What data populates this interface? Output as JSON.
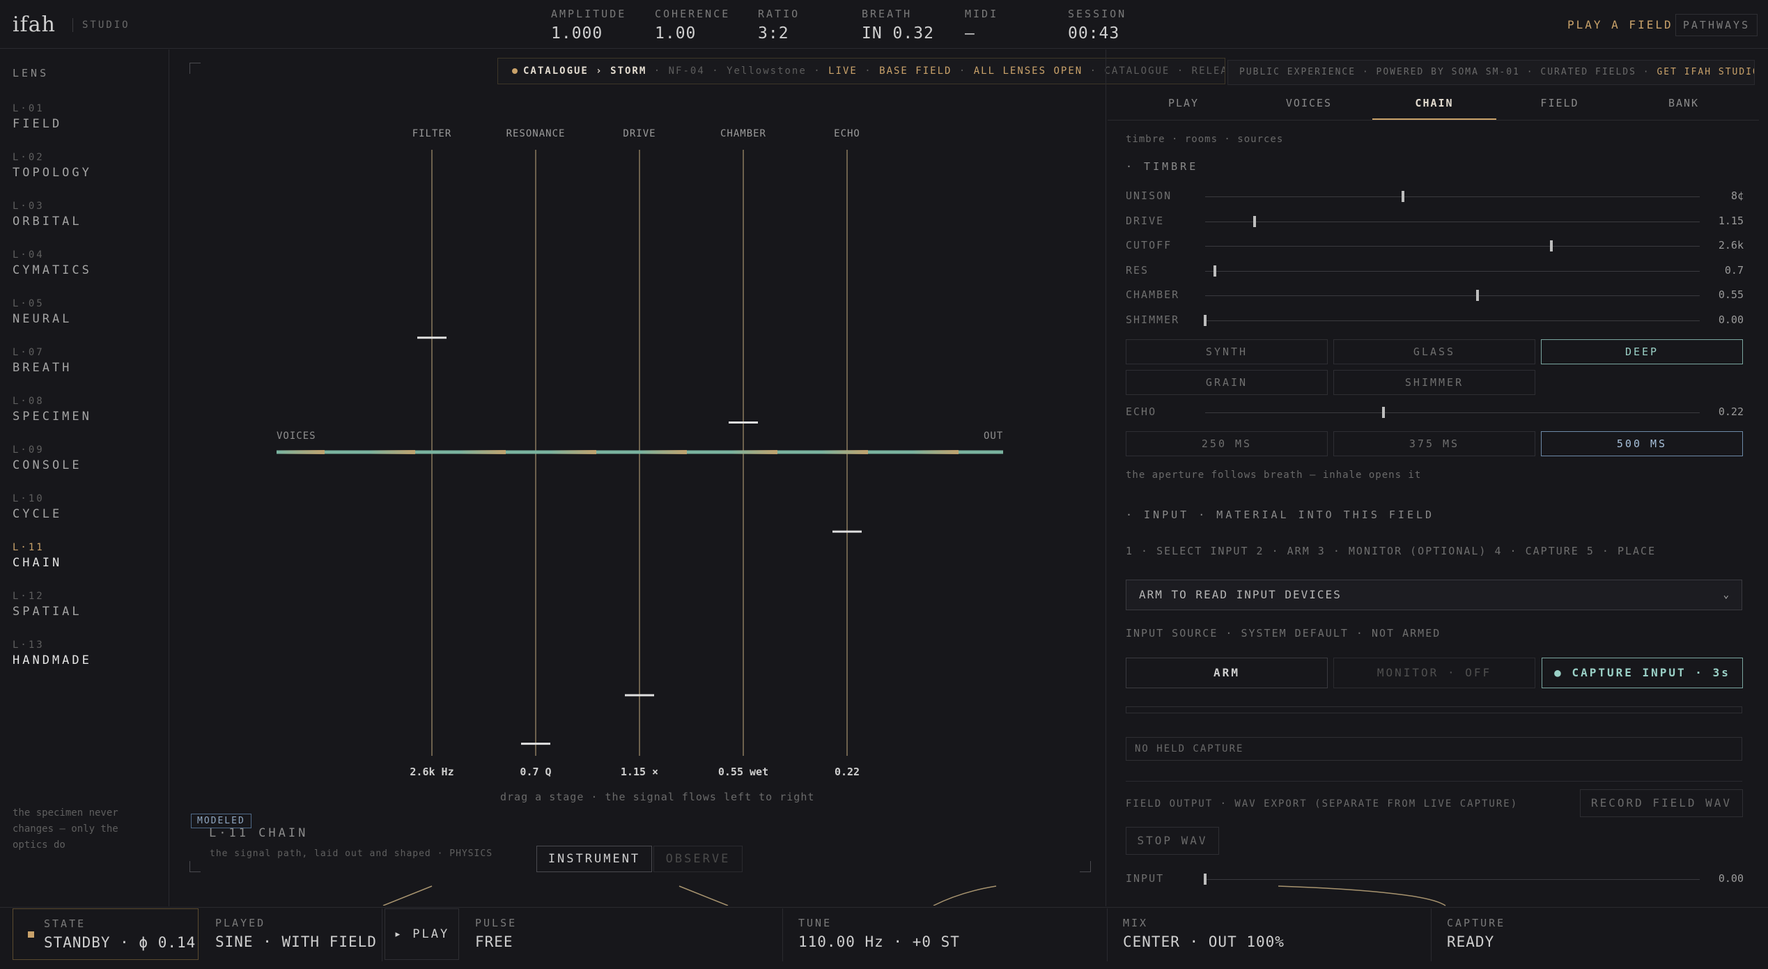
{
  "brand": {
    "logo": "ifah",
    "studio": "STUDIO"
  },
  "metrics": [
    {
      "label": "AMPLITUDE",
      "value": "1.000"
    },
    {
      "label": "COHERENCE",
      "value": "1.00"
    },
    {
      "label": "RATIO",
      "value": "3:2"
    },
    {
      "label": "BREATH",
      "value": "IN 0.32"
    },
    {
      "label": "MIDI",
      "value": "—"
    },
    {
      "label": "SESSION",
      "value": "00:43"
    }
  ],
  "topnav": {
    "play_field": "PLAY A FIELD",
    "pathways": "PATHWAYS"
  },
  "sidebar": {
    "title": "LENS",
    "items": [
      {
        "code": "L·01",
        "name": "FIELD"
      },
      {
        "code": "L·02",
        "name": "TOPOLOGY"
      },
      {
        "code": "L·03",
        "name": "ORBITAL"
      },
      {
        "code": "L·04",
        "name": "CYMATICS"
      },
      {
        "code": "L·05",
        "name": "NEURAL"
      },
      {
        "code": "L·07",
        "name": "BREATH"
      },
      {
        "code": "L·08",
        "name": "SPECIMEN"
      },
      {
        "code": "L·09",
        "name": "CONSOLE"
      },
      {
        "code": "L·10",
        "name": "CYCLE"
      },
      {
        "code": "L·11",
        "name": "CHAIN"
      },
      {
        "code": "L·12",
        "name": "SPATIAL"
      },
      {
        "code": "L·13",
        "name": "HANDMADE"
      }
    ],
    "note": "the specimen never changes — only the optics do"
  },
  "catalogue_bar": {
    "path": "CATALOGUE › STORM",
    "id": "NF-04",
    "place": "Yellowstone",
    "live": "LIVE",
    "base": "BASE FIELD",
    "lenses": "ALL LENSES OPEN",
    "catalogue": "CATALOGUE",
    "release": "RELEAS",
    "sep": "·"
  },
  "chain": {
    "voices_label": "VOICES",
    "out_label": "OUT",
    "stages": [
      {
        "label": "FILTER",
        "value": "2.6k Hz",
        "level": 0.69
      },
      {
        "label": "RESONANCE",
        "value": "0.7 Q",
        "level": 0.02
      },
      {
        "label": "DRIVE",
        "value": "1.15 ×",
        "level": 0.1
      },
      {
        "label": "CHAMBER",
        "value": "0.55 wet",
        "level": 0.55
      },
      {
        "label": "ECHO",
        "value": "0.22",
        "level": 0.37
      }
    ],
    "hint": "drag a stage · the signal flows left to right",
    "modeled": "MODELED",
    "title": "L·11 CHAIN",
    "subtitle": "the signal path, laid out and shaped · PHYSICS",
    "mode_instrument": "INSTRUMENT",
    "mode_observe": "OBSERVE",
    "colors": {
      "signal": "#7ab39f",
      "stage_line": "#a8946f",
      "thumb": "#e0e0e0"
    }
  },
  "public_bar": {
    "text": "PUBLIC EXPERIENCE · POWERED BY SOMA SM-01 · CURATED FIELDS",
    "cta": "GET IFAH STUDIO →"
  },
  "tabs": [
    "PLAY",
    "VOICES",
    "CHAIN",
    "FIELD",
    "BANK"
  ],
  "right": {
    "crumbs": "timbre · rooms · sources",
    "timbre_title": "· TIMBRE",
    "sliders": [
      {
        "label": "UNISON",
        "value": "8¢",
        "fraction": 0.4
      },
      {
        "label": "DRIVE",
        "value": "1.15",
        "fraction": 0.1
      },
      {
        "label": "CUTOFF",
        "value": "2.6k",
        "fraction": 0.7
      },
      {
        "label": "RES",
        "value": "0.7",
        "fraction": 0.02
      },
      {
        "label": "CHAMBER",
        "value": "0.55",
        "fraction": 0.55
      },
      {
        "label": "SHIMMER",
        "value": "0.00",
        "fraction": 0.0
      }
    ],
    "presets": [
      "SYNTH",
      "GLASS",
      "DEEP",
      "GRAIN",
      "SHIMMER"
    ],
    "echo": {
      "label": "ECHO",
      "value": "0.22",
      "fraction": 0.36
    },
    "echo_times": [
      "250 MS",
      "375 MS",
      "500 MS"
    ],
    "aperture_note": "the aperture follows breath — inhale opens it",
    "input_title": "· INPUT · MATERIAL INTO THIS FIELD",
    "steps": "1 · SELECT INPUT 2 · ARM 3 · MONITOR (OPTIONAL) 4 · CAPTURE 5 · PLACE",
    "arm_select": "ARM TO READ INPUT DEVICES",
    "input_source": "INPUT SOURCE · SYSTEM DEFAULT · NOT ARMED",
    "arm": "ARM",
    "monitor": "MONITOR · OFF",
    "capture": "● CAPTURE INPUT · 3s",
    "no_held": "NO HELD CAPTURE",
    "field_output": "FIELD OUTPUT · WAV EXPORT (SEPARATE FROM LIVE CAPTURE)",
    "record": "RECORD FIELD WAV",
    "stop": "STOP WAV",
    "input_level": {
      "label": "INPUT",
      "value": "0.00",
      "fraction": 0.0
    }
  },
  "bottom": {
    "state": {
      "label": "STATE",
      "value": "STANDBY · ϕ 0.14"
    },
    "played": {
      "label": "PLAYED",
      "value": "SINE · WITH FIELD"
    },
    "play": "▸ PLAY",
    "pulse": {
      "label": "PULSE",
      "value": "FREE"
    },
    "tune": {
      "label": "TUNE",
      "value": "110.00 Hz · +0 ST"
    },
    "mix": {
      "label": "MIX",
      "value": "CENTER · OUT 100%"
    },
    "capture": {
      "label": "CAPTURE",
      "value": "READY"
    }
  }
}
